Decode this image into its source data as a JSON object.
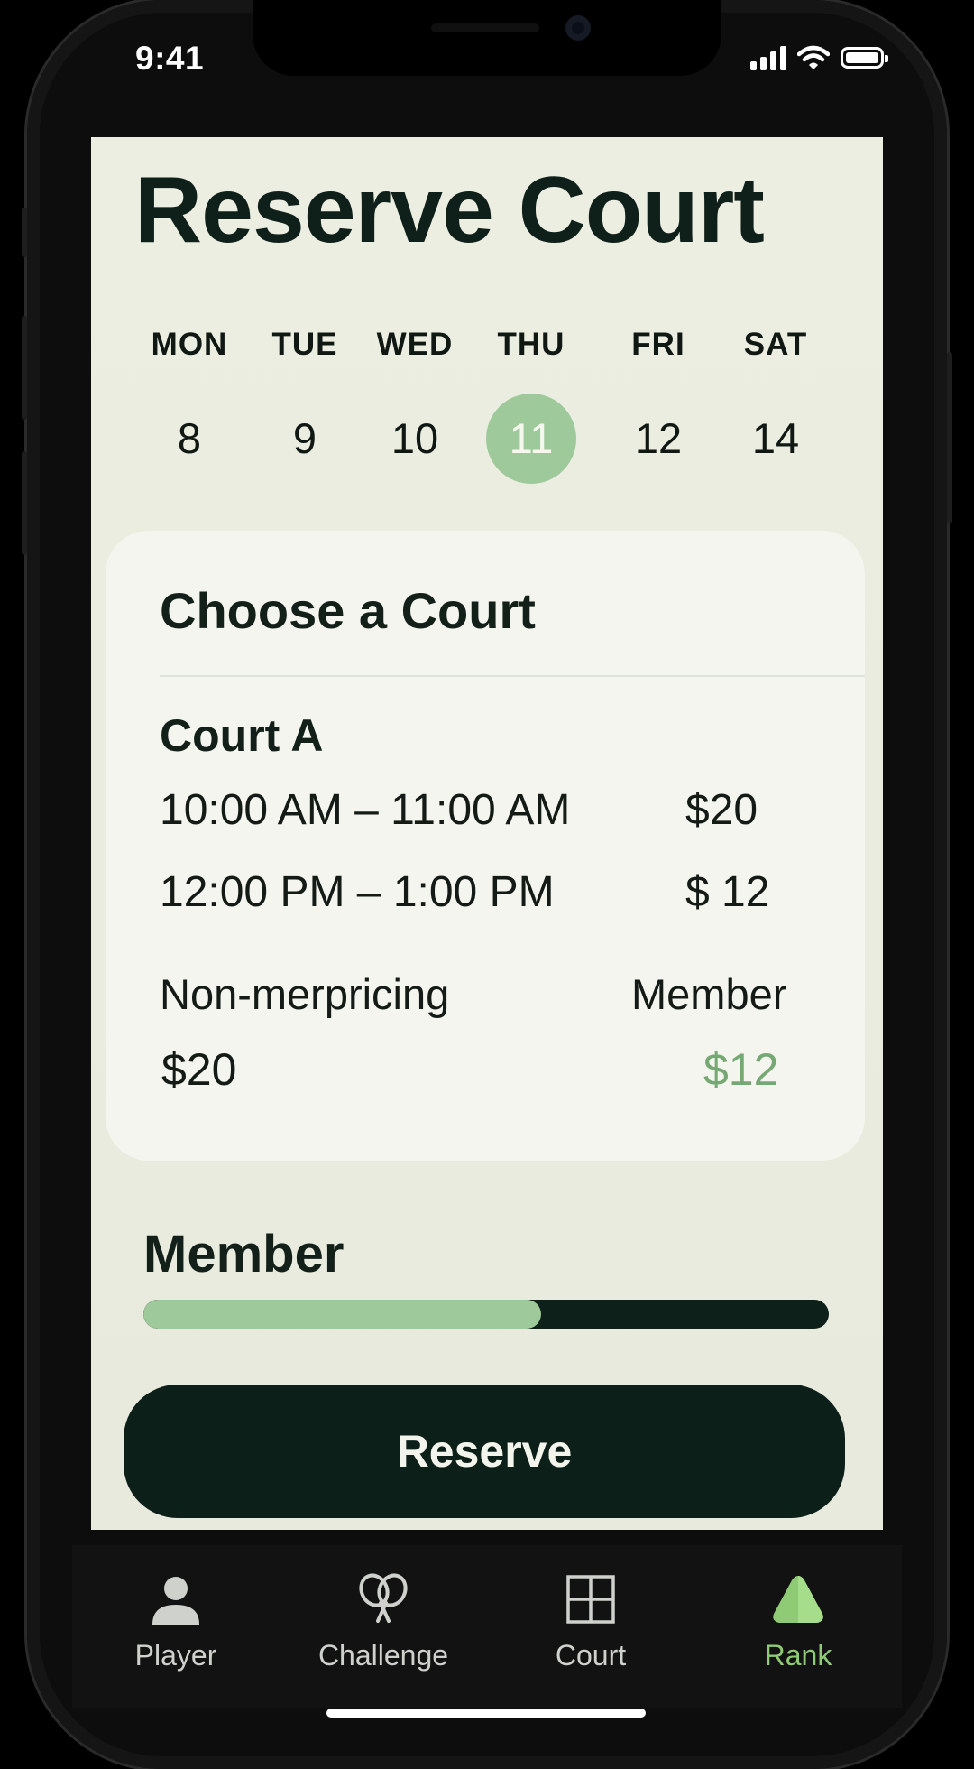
{
  "status_bar": {
    "time": "9:41"
  },
  "page": {
    "title": "Reserve Court"
  },
  "calendar": {
    "days": [
      {
        "name": "MON",
        "num": "8"
      },
      {
        "name": "TUE",
        "num": "9"
      },
      {
        "name": "WED",
        "num": "10"
      },
      {
        "name": "THU",
        "num": "11",
        "selected": true
      },
      {
        "name": "FRI",
        "num": "12"
      },
      {
        "name": "SAT",
        "num": "14"
      }
    ]
  },
  "court_card": {
    "title": "Choose a Court",
    "court_name": "Court A",
    "slots": [
      {
        "time": "10:00 AM – 11:00 AM",
        "price": "$20"
      },
      {
        "time": "12:00 PM – 1:00 PM",
        "price": "$ 12"
      }
    ],
    "pricing": {
      "non_member_label": "Non-merpricing",
      "member_label": "Member",
      "non_member_price": "$20",
      "member_price": "$12"
    }
  },
  "membership": {
    "label": "Member",
    "progress_fraction": 0.58
  },
  "actions": {
    "reserve_label": "Reserve"
  },
  "tabbar": {
    "items": [
      {
        "label": "Player",
        "icon": "person-icon"
      },
      {
        "label": "Challenge",
        "icon": "rackets-icon"
      },
      {
        "label": "Court",
        "icon": "court-grid-icon"
      },
      {
        "label": "Rank",
        "icon": "triangle-icon",
        "active": true
      }
    ]
  },
  "colors": {
    "accent_green": "#9ec99b",
    "dark_green": "#0d1f19",
    "member_price_green": "#76a874",
    "active_tab_green": "#8fcb74"
  }
}
